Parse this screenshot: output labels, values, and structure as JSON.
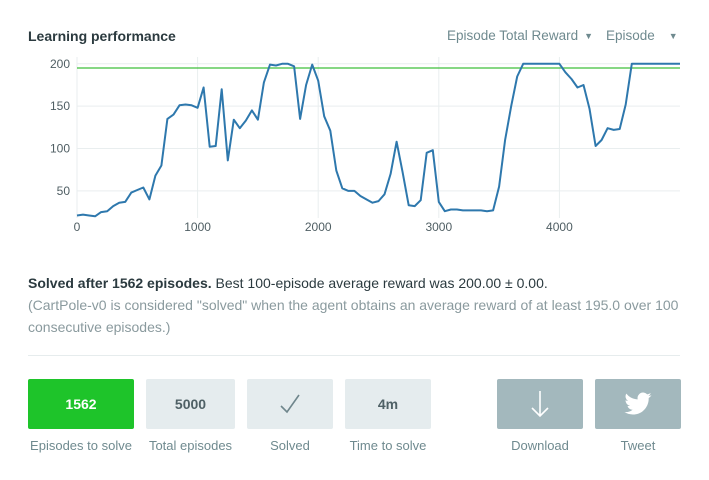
{
  "header": {
    "title": "Learning performance",
    "metric_select": "Episode Total Reward",
    "xaxis_select": "Episode"
  },
  "chart_data": {
    "type": "line",
    "title": "",
    "xlabel": "",
    "ylabel": "",
    "xlim": [
      0,
      5000
    ],
    "ylim": [
      18,
      208
    ],
    "x_ticks": [
      0,
      1000,
      2000,
      3000,
      4000
    ],
    "y_ticks": [
      50,
      100,
      150,
      200
    ],
    "grid": true,
    "threshold": {
      "value": 195,
      "color": "#3fbf3a"
    },
    "series": [
      {
        "color": "#2e78ad",
        "x": [
          0,
          50,
          100,
          150,
          200,
          250,
          300,
          350,
          400,
          450,
          500,
          550,
          600,
          650,
          700,
          750,
          800,
          850,
          900,
          950,
          1000,
          1050,
          1100,
          1150,
          1200,
          1250,
          1300,
          1350,
          1400,
          1450,
          1500,
          1550,
          1600,
          1650,
          1700,
          1750,
          1800,
          1850,
          1900,
          1950,
          2000,
          2050,
          2100,
          2150,
          2200,
          2250,
          2300,
          2350,
          2400,
          2450,
          2500,
          2550,
          2600,
          2650,
          2700,
          2750,
          2800,
          2850,
          2900,
          2950,
          3000,
          3050,
          3100,
          3150,
          3200,
          3250,
          3300,
          3350,
          3400,
          3450,
          3500,
          3550,
          3600,
          3650,
          3700,
          3750,
          3800,
          3850,
          3900,
          3950,
          4000,
          4050,
          4100,
          4150,
          4200,
          4250,
          4300,
          4350,
          4400,
          4450,
          4500,
          4550,
          4600,
          4650,
          4700,
          4750,
          4800,
          4850,
          4900,
          4950,
          5000
        ],
        "values": [
          21,
          22,
          21,
          20,
          25,
          26,
          32,
          36,
          37,
          48,
          51,
          54,
          40,
          68,
          80,
          135,
          140,
          151,
          152,
          151,
          148,
          172,
          102,
          103,
          170,
          86,
          134,
          124,
          133,
          145,
          134,
          178,
          199,
          198,
          200,
          200,
          197,
          135,
          175,
          199,
          180,
          138,
          121,
          74,
          53,
          50,
          50,
          44,
          40,
          36,
          38,
          46,
          70,
          108,
          72,
          33,
          32,
          39,
          95,
          98,
          37,
          26,
          28,
          28,
          27,
          27,
          27,
          27,
          26,
          27,
          55,
          110,
          150,
          185,
          200,
          200,
          200,
          200,
          200,
          200,
          200,
          190,
          182,
          172,
          175,
          147,
          103,
          110,
          124,
          122,
          123,
          152,
          200,
          200,
          200,
          200,
          200,
          200,
          200,
          200,
          200
        ]
      }
    ]
  },
  "summary": {
    "headline": "Solved after 1562 episodes.",
    "detail": "Best 100-episode average reward was 200.00 ± 0.00.",
    "note": "(CartPole-v0 is considered \"solved\" when the agent obtains an average reward of at least 195.0 over 100 consecutive episodes.)"
  },
  "stats": {
    "episodes_to_solve": {
      "value": "1562",
      "label": "Episodes to solve"
    },
    "total_episodes": {
      "value": "5000",
      "label": "Total episodes"
    },
    "solved": {
      "label": "Solved",
      "icon": "checkmark-icon"
    },
    "time_to_solve": {
      "value": "4m",
      "label": "Time to solve"
    },
    "download": {
      "label": "Download",
      "icon": "download-arrow-icon"
    },
    "tweet": {
      "label": "Tweet",
      "icon": "twitter-bird-icon"
    }
  },
  "colors": {
    "accent_green": "#1ec42a",
    "tile_light": "#e5ecee",
    "tile_slate": "#a3b8bd",
    "line": "#2e78ad",
    "threshold": "#3fbf3a"
  }
}
